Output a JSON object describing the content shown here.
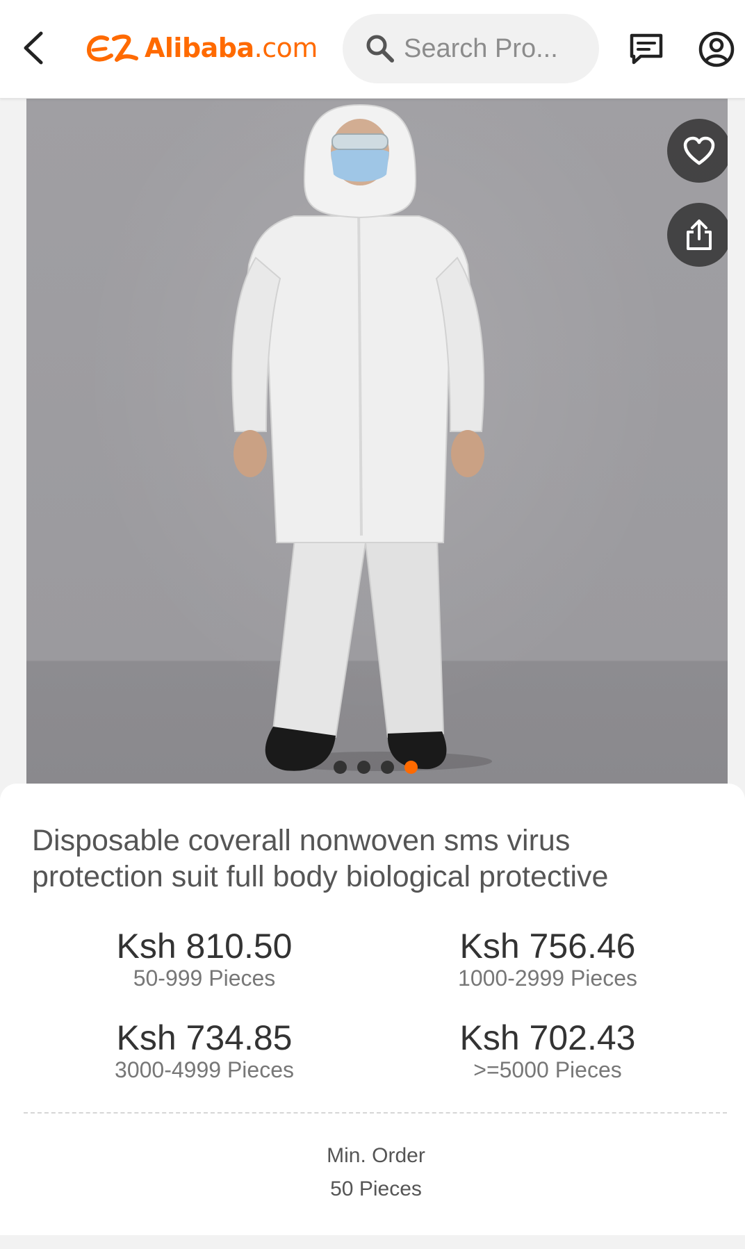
{
  "header": {
    "logo_text": "Alibaba",
    "logo_domain": ".com",
    "search_placeholder": "Search Pro...",
    "back_icon": "chevron-left-icon",
    "message_icon": "message-icon",
    "account_icon": "account-icon"
  },
  "gallery": {
    "image_count": 4,
    "active_index": 3,
    "favorite_icon": "heart-icon",
    "share_icon": "share-icon"
  },
  "product": {
    "title": "Disposable coverall nonwoven sms virus protection suit full body biological protective",
    "tiers": [
      {
        "price": "Ksh 810.50",
        "range": "50-999 Pieces"
      },
      {
        "price": "Ksh 756.46",
        "range": "1000-2999 Pieces"
      },
      {
        "price": "Ksh 734.85",
        "range": "3000-4999 Pieces"
      },
      {
        "price": "Ksh 702.43",
        "range": ">=5000 Pieces"
      }
    ],
    "min_order_label": "Min. Order",
    "min_order_value": "50 Pieces"
  },
  "colors": {
    "brand": "#ff6a00",
    "text": "#333333",
    "muted": "#777777"
  }
}
